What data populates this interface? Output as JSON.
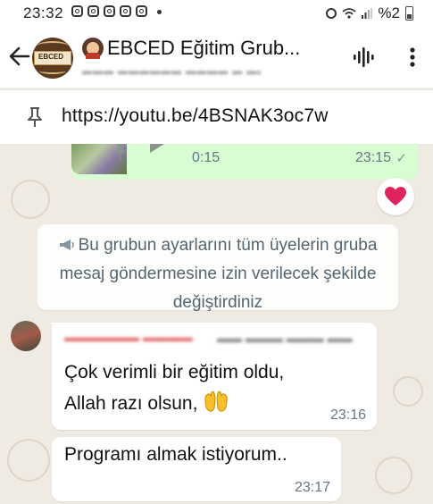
{
  "status_bar": {
    "time": "23:32",
    "battery": "%2"
  },
  "header": {
    "group_name": "EBCED Eğitim Grub...",
    "group_avatar_text": "EBCED"
  },
  "pinned": {
    "text": "https://youtu.be/4BSNAK3oc7w"
  },
  "voice_message": {
    "duration": "0:15",
    "time": "23:15",
    "status": "✓"
  },
  "reaction": {
    "emoji": "heart"
  },
  "system_message": {
    "text": "Bu grubun ayarlarını tüm üyelerin gruba mesaj göndermesine izin verilecek şekilde değiştirdiniz"
  },
  "messages": [
    {
      "text_line1": "Çok verimli bir eğitim oldu,",
      "text_line2": "Allah razı olsun,",
      "time": "23:16"
    },
    {
      "text": "Programı almak istiyorum..",
      "time": "23:17"
    }
  ],
  "colors": {
    "outgoing_bubble": "#d9fdd3",
    "incoming_bubble": "#ffffff",
    "chat_background": "#efeae2",
    "reaction_heart": "#e0245e"
  }
}
